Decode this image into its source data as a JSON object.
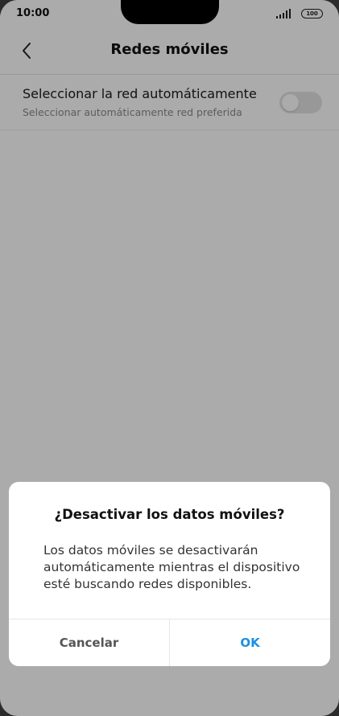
{
  "status_bar": {
    "time": "10:00",
    "signal_icon": "cellular-signal-icon",
    "battery_icon": "battery-icon",
    "battery_level": "100"
  },
  "header": {
    "back_icon": "chevron-left-icon",
    "title": "Redes móviles"
  },
  "settings": {
    "auto_network": {
      "title": "Seleccionar la red automáticamente",
      "subtitle": "Seleccionar automáticamente red preferida",
      "enabled": false
    }
  },
  "dialog": {
    "title": "¿Desactivar los datos móviles?",
    "message": "Los datos móviles se desactivarán automáticamente mientras el dispositivo esté buscando redes disponibles.",
    "cancel_label": "Cancelar",
    "ok_label": "OK",
    "ok_color": "#1a8fe3"
  },
  "nav_bar": {
    "recents_icon": "square-recents-icon",
    "home_icon": "circle-home-icon",
    "back_icon": "triangle-back-icon"
  }
}
